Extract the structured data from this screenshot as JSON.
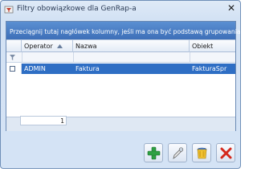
{
  "window": {
    "title": "Filtry obowiązkowe dla GenRap-a"
  },
  "grid": {
    "group_prompt": "Przeciągnij tutaj nagłówek kolumny, jeśli ma ona być podstawą grupowania",
    "columns": [
      "Operator",
      "Nazwa",
      "Obiekt"
    ],
    "rows": [
      {
        "operator": "ADMIN",
        "nazwa": "Faktura",
        "obiekt": "FakturaSpr"
      }
    ],
    "record_count": "1"
  },
  "icons": {
    "app": "filter-app-icon",
    "sort": "sort-ascending-icon",
    "filter": "funnel-icon",
    "add": "plus-icon",
    "edit": "pencil-icon",
    "delete_all": "trash-can-icon",
    "close": "red-x-icon"
  },
  "colors": {
    "group_bar": "#4a80c8",
    "selected_row": "#2e6ec4",
    "add_green": "#2ea043",
    "close_red": "#d4281c"
  }
}
